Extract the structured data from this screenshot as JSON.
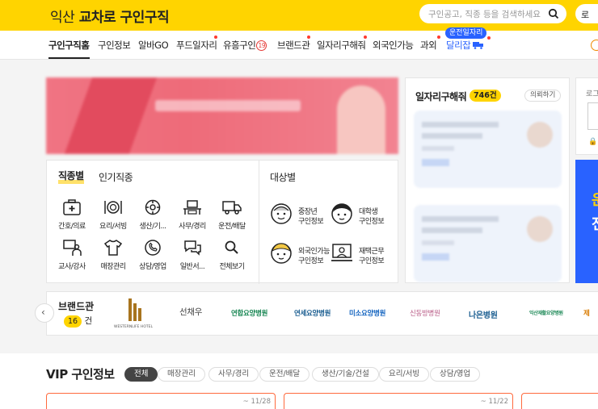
{
  "header": {
    "logo_city": "익산",
    "logo_brand": "교차로",
    "logo_service": "구인구직",
    "search_placeholder": "구인공고, 직종 등을 검색하세요",
    "right_btn": "로"
  },
  "nav": {
    "items": [
      {
        "label": "구인구직홈"
      },
      {
        "label": "구인정보"
      },
      {
        "label": "알바GO"
      },
      {
        "label": "푸드일자리"
      },
      {
        "label": "유흥구인"
      },
      {
        "label": "브랜드관"
      },
      {
        "label": "일자리구해줘"
      },
      {
        "label": "외국인가능"
      },
      {
        "label": "과외"
      },
      {
        "label": "달리잡"
      }
    ],
    "adult_badge": "19",
    "drive_tag": "운전일자리"
  },
  "categories": {
    "tab_job": "직종별",
    "tab_popular": "인기직종",
    "tab_target": "대상별",
    "items": [
      {
        "label": "간호/의료",
        "icon": "medical-kit-icon"
      },
      {
        "label": "요리/서빙",
        "icon": "plate-icon"
      },
      {
        "label": "생산/기...",
        "icon": "gear-icon"
      },
      {
        "label": "사무/경리",
        "icon": "desk-icon"
      },
      {
        "label": "운전/배달",
        "icon": "truck-icon"
      },
      {
        "label": "교사/강사",
        "icon": "teacher-icon"
      },
      {
        "label": "매장관리",
        "icon": "shirt-icon"
      },
      {
        "label": "상담/영업",
        "icon": "phone-icon"
      },
      {
        "label": "일반서...",
        "icon": "chat-icon"
      },
      {
        "label": "전체보기",
        "icon": "search-icon"
      }
    ],
    "targets": [
      {
        "line1": "중장년",
        "line2": "구인정보",
        "icon": "senior-face-icon"
      },
      {
        "line1": "대학생",
        "line2": "구인정보",
        "icon": "student-face-icon"
      },
      {
        "line1": "외국인가능",
        "line2": "구인정보",
        "icon": "foreigner-face-icon"
      },
      {
        "line1": "재택근무",
        "line2": "구인정보",
        "icon": "remote-work-icon"
      }
    ]
  },
  "jobs_panel": {
    "title": "일자리구해줘",
    "count": "746건",
    "request_btn": "의뢰하기"
  },
  "right_col": {
    "login_label": "로그"
  },
  "brands": {
    "title": "브랜드관",
    "count": "16",
    "count_unit": "건",
    "logos": [
      {
        "name": "WESTERNLIFE HOTEL"
      },
      {
        "name": "선채우"
      },
      {
        "name": "연합요양병원"
      },
      {
        "name": "연세요양병원"
      },
      {
        "name": "미소요양병원"
      },
      {
        "name": "신동방병원"
      },
      {
        "name": "나은병원"
      },
      {
        "name": "익산재활요양병원"
      },
      {
        "name": "제"
      }
    ]
  },
  "vip": {
    "title": "VIP 구인정보",
    "chips": [
      "전체",
      "매장관리",
      "사무/경리",
      "운전/배달",
      "생산/기술/건설",
      "요리/서빙",
      "상담/영업"
    ],
    "card_dates": [
      "~ 11/28",
      "~ 11/22"
    ]
  },
  "colors": {
    "brand_yellow": "#ffd400",
    "accent_blue": "#2962ff",
    "alert_red": "#ff3b30",
    "card_border": "#ff6a3d"
  }
}
